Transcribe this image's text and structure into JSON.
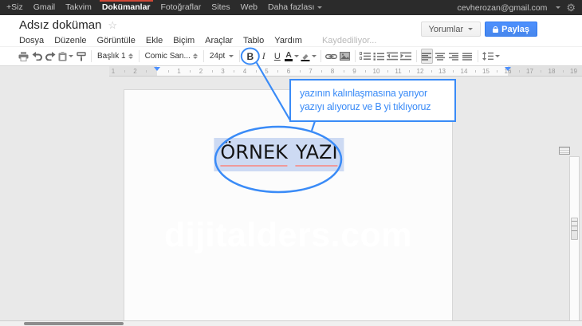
{
  "colors": {
    "topbar_red": "#d14836",
    "annotation_blue": "#3a8bf7",
    "share_blue": "#4d90fe",
    "selection": "#cddaf3"
  },
  "topbar": {
    "items": [
      "+Siz",
      "Gmail",
      "Takvim",
      "Dokümanlar",
      "Fotoğraflar",
      "Sites",
      "Web",
      "Daha fazlası"
    ],
    "active_item": "Dokümanlar",
    "account_email": "cevherozan@gmail.com",
    "gear_icon": "gear"
  },
  "header": {
    "doc_title": "Adsız doküman",
    "menus": [
      "Dosya",
      "Düzenle",
      "Görüntüle",
      "Ekle",
      "Biçim",
      "Araçlar",
      "Tablo",
      "Yardım"
    ],
    "saving_status": "Kaydediliyor...",
    "comments_button": "Yorumlar",
    "share_button": "Paylaş"
  },
  "toolbar": {
    "style_value": "Başlık 1",
    "font_value": "Comic San...",
    "size_value": "24pt",
    "bold_label": "B",
    "italic_label": "I",
    "underline_label": "U",
    "text_color_label": "A",
    "highlighted_button": "bold",
    "active_align": "align-left",
    "icons": [
      "print",
      "undo",
      "redo",
      "paste",
      "paint-format",
      "text-color",
      "fill-color",
      "insert-link",
      "insert-image",
      "numbered-list",
      "bulleted-list",
      "decrease-indent",
      "increase-indent",
      "align-left",
      "align-center",
      "align-right",
      "justify",
      "line-spacing"
    ]
  },
  "ruler": {
    "left_labels": [
      "2",
      "1"
    ],
    "labels": [
      "1",
      "2",
      "3",
      "4",
      "5",
      "6",
      "7",
      "8",
      "9",
      "10",
      "11",
      "12",
      "13",
      "14",
      "15",
      "16",
      "17",
      "18",
      "19"
    ]
  },
  "document": {
    "selected_text": "ÖRNEK YAZI",
    "selected_text_words": [
      "ÖRNEK",
      "YAZI"
    ],
    "watermark": "dijitalders.com"
  },
  "annotation": {
    "callout_line1": "yazının kalınlaşmasına yarıyor",
    "callout_line2": "yazıyı alıyoruz ve B yi tıklıyoruz"
  }
}
